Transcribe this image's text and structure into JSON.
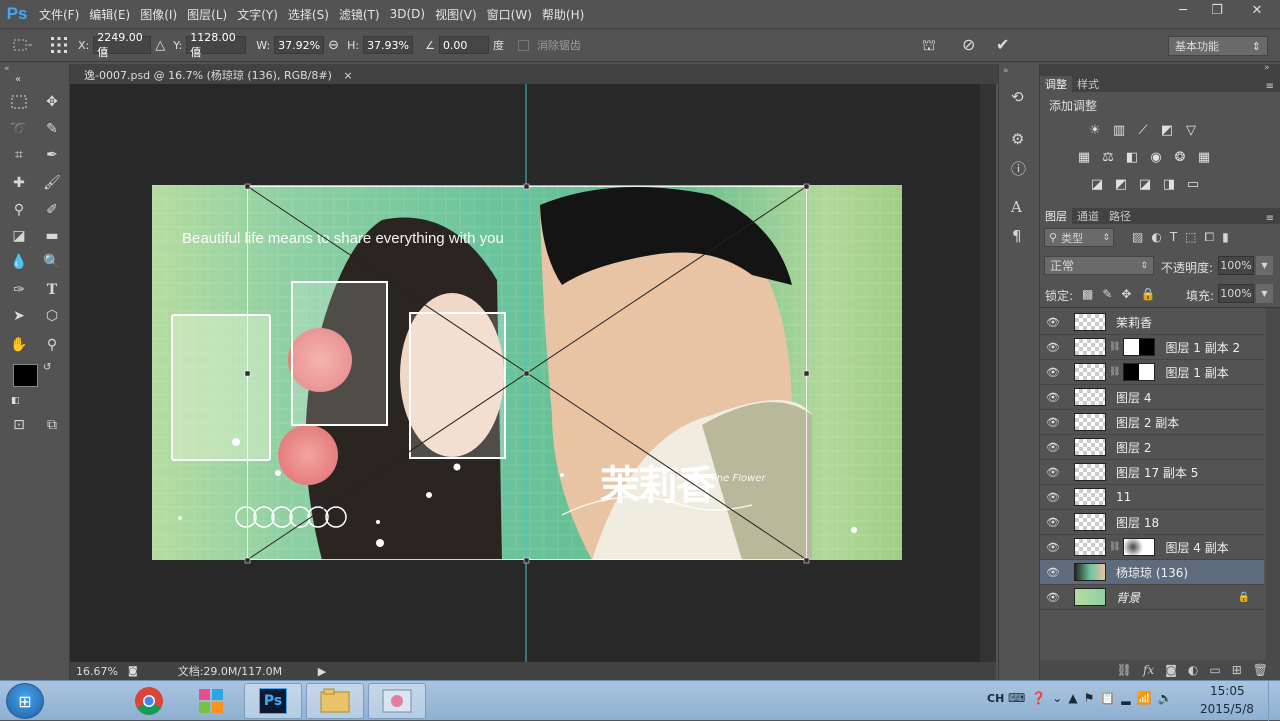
{
  "app": {
    "logo": "Ps"
  },
  "menu": [
    "文件(F)",
    "编辑(E)",
    "图像(I)",
    "图层(L)",
    "文字(Y)",
    "选择(S)",
    "滤镜(T)",
    "3D(D)",
    "视图(V)",
    "窗口(W)",
    "帮助(H)"
  ],
  "window_controls": {
    "minimize": "─",
    "restore": "❐",
    "close": "✕"
  },
  "options": {
    "x_label": "X:",
    "x_value": "2249.00 僖",
    "y_label": "Y:",
    "y_value": "1128.00 僖",
    "w_label": "W:",
    "w_value": "37.92%",
    "h_label": "H:",
    "h_value": "37.93%",
    "angle_value": "0.00",
    "angle_unit": "度",
    "antialias_label": "消除锯齿",
    "workspace": "基本功能"
  },
  "document": {
    "tab": "逸-0007.psd @ 16.7% (杨琼琼 (136), RGB/8#)",
    "tab_close": "×"
  },
  "photo": {
    "caption": "Beautiful life means to share everything with you",
    "title_small": "Jasmine Flower",
    "title_cn": "茉莉香"
  },
  "status": {
    "zoom": "16.67%",
    "doc_info": "文档:29.0M/117.0M"
  },
  "adjust_panel": {
    "tabs": [
      "调整",
      "样式"
    ],
    "heading": "添加调整"
  },
  "layers_panel": {
    "tabs": [
      "图层",
      "通道",
      "路径"
    ],
    "kind_filter": "类型",
    "blend_mode": "正常",
    "opacity_label": "不透明度:",
    "opacity_value": "100%",
    "lock_label": "锁定:",
    "fill_label": "填充:",
    "fill_value": "100%",
    "layers": [
      {
        "name": "茉莉香",
        "mask": "none",
        "selected": false,
        "italic": false
      },
      {
        "name": "图层 1 副本 2",
        "mask": "white-black",
        "selected": false,
        "italic": false
      },
      {
        "name": "图层 1 副本",
        "mask": "black-white",
        "selected": false,
        "italic": false
      },
      {
        "name": "图层 4",
        "mask": "none",
        "selected": false,
        "italic": false
      },
      {
        "name": "图层 2 副本",
        "mask": "none",
        "selected": false,
        "italic": false
      },
      {
        "name": "图层 2",
        "mask": "none",
        "selected": false,
        "italic": false
      },
      {
        "name": "图层 17 副本 5",
        "mask": "none",
        "selected": false,
        "italic": false
      },
      {
        "name": "11",
        "mask": "none",
        "selected": false,
        "italic": false
      },
      {
        "name": "图层 18",
        "mask": "none",
        "selected": false,
        "italic": false
      },
      {
        "name": "图层 4 副本",
        "mask": "soft",
        "selected": false,
        "italic": false
      },
      {
        "name": "杨琼琼 (136)",
        "mask": "photo",
        "selected": true,
        "italic": false
      },
      {
        "name": "背景",
        "mask": "green",
        "selected": false,
        "italic": true
      }
    ]
  },
  "taskbar": {
    "ime": "CH",
    "time": "15:05",
    "date": "2015/5/8"
  },
  "colors": {
    "accent": "#3fa9f5",
    "selection": "#5d6b7c",
    "panel": "#535353",
    "canvas": "#282828",
    "guide": "#38c6d8"
  }
}
